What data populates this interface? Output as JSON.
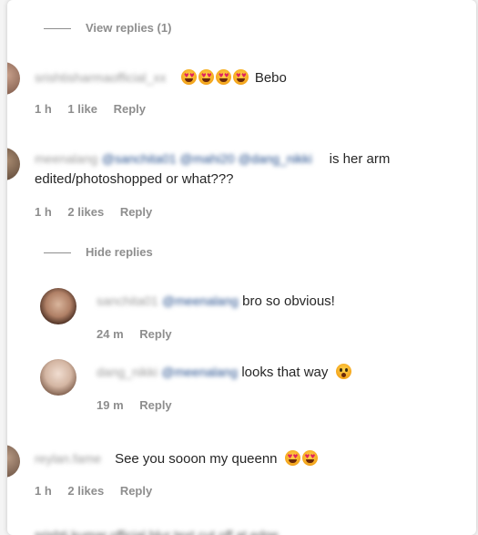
{
  "thread": {
    "view_replies_label": "View replies (1)",
    "hide_replies_label": "Hide replies"
  },
  "comments": [
    {
      "username": "srishtisharmaofficial_xx",
      "text": "Bebo",
      "emojis": [
        "heart-eyes-emoji",
        "heart-eyes-emoji",
        "heart-eyes-emoji",
        "heart-eyes-emoji"
      ],
      "time": "1 h",
      "likes": "1 like",
      "reply": "Reply"
    },
    {
      "username": "meenalang",
      "mentions": "@sanchita01 @mahi20 @dang_nikki",
      "text_line1": "is her arm",
      "text_line2": "edited/photoshopped or what???",
      "time": "1 h",
      "likes": "2 likes",
      "reply": "Reply",
      "replies": [
        {
          "username": "sanchita01",
          "mention": "@meenalang",
          "text": "bro so obvious!",
          "time": "24 m",
          "reply": "Reply"
        },
        {
          "username": "dang_nikki",
          "mention": "@meenalang",
          "text": "looks that way",
          "emoji": "surprised-face-emoji",
          "time": "19 m",
          "reply": "Reply"
        }
      ]
    },
    {
      "username": "reylan.fame",
      "text": "See you sooon my queenn",
      "emojis": [
        "heart-eyes-emoji",
        "heart-eyes-emoji"
      ],
      "time": "1 h",
      "likes": "2 likes",
      "reply": "Reply"
    }
  ],
  "partial_bottom_comment": "srishti.kumar.official.blur text cut off at edge"
}
